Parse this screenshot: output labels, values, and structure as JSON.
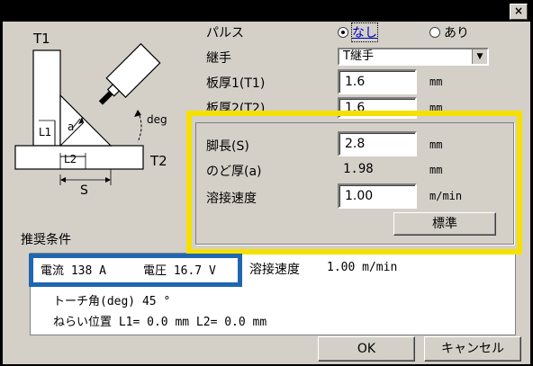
{
  "window": {
    "close_label": "×"
  },
  "diagram": {
    "t1": "T1",
    "t2": "T2",
    "l1": "L1",
    "l2": "L2",
    "a": "a",
    "s": "S",
    "deg": "deg"
  },
  "pulse": {
    "label": "パルス",
    "opt_none": "なし",
    "opt_yes": "あり",
    "selected": "なし"
  },
  "joint": {
    "label": "継手",
    "value": "T継手"
  },
  "thickness1": {
    "label": "板厚1(T1)",
    "value": "1.6",
    "unit": "mm"
  },
  "thickness2": {
    "label": "板厚2(T2)",
    "value": "1.6",
    "unit": "mm"
  },
  "leg": {
    "label": "脚長(S)",
    "value": "2.8",
    "unit": "mm"
  },
  "throat": {
    "label": "のど厚(a)",
    "value": "1.98",
    "unit": "mm"
  },
  "speed": {
    "label": "溶接速度",
    "value": "1.00",
    "unit": "m/min"
  },
  "standard_button": "標準",
  "recommend": {
    "title": "推奨条件",
    "line1_current": "電流 138 A",
    "line1_voltage": "電圧 16.7 V",
    "line1_speed_label": "溶接速度",
    "line1_speed_value": "1.00 m/min",
    "line2": "トーチ角(deg)  45 °",
    "line3": "ねらい位置  L1=  0.0 mm  L2=  0.0 mm"
  },
  "ok_button": "OK",
  "cancel_button": "キャンセル",
  "colors": {
    "highlight_yellow": "#f5e000",
    "highlight_blue": "#1f67b1",
    "dialog_bg": "#d4d0c8"
  }
}
